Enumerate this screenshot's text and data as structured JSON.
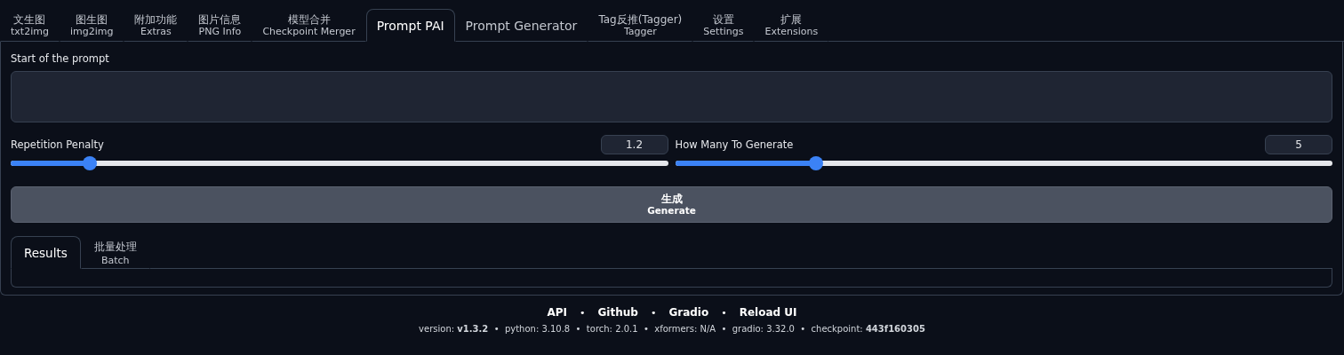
{
  "tabs": [
    {
      "label": "文生图",
      "sub": "txt2img",
      "selected": false
    },
    {
      "label": "图生图",
      "sub": "img2img",
      "selected": false
    },
    {
      "label": "附加功能",
      "sub": "Extras",
      "selected": false
    },
    {
      "label": "图片信息",
      "sub": "PNG Info",
      "selected": false
    },
    {
      "label": "模型合并",
      "sub": "Checkpoint Merger",
      "selected": false
    },
    {
      "label": "Prompt PAI",
      "selected": true
    },
    {
      "label": "Prompt Generator",
      "selected": false
    },
    {
      "label": "Tag反推(Tagger)",
      "sub": "Tagger",
      "selected": false
    },
    {
      "label": "设置",
      "sub": "Settings",
      "selected": false
    },
    {
      "label": "扩展",
      "sub": "Extensions",
      "selected": false
    }
  ],
  "prompt_field": {
    "label": "Start of the prompt"
  },
  "sliders": [
    {
      "label": "Repetition Penalty",
      "value": "1.2",
      "level": 0.12
    },
    {
      "label": "How Many To Generate",
      "value": "5",
      "level": 0.215
    }
  ],
  "generate_button": {
    "label": "生成",
    "sub": "Generate"
  },
  "result_tabs": [
    {
      "label": "Results",
      "selected": true
    },
    {
      "label": "批量处理",
      "sub": "Batch",
      "selected": false
    }
  ],
  "footer": {
    "links": [
      "API",
      "Github",
      "Gradio",
      "Reload UI"
    ],
    "separators": [
      "•",
      "•",
      "•"
    ],
    "version_line": "version: **v1.3.2**  •  python: 3.10.8  •  torch: 2.0.1  •  xformers: N/A  •  gradio: 3.32.0  •  checkpoint: **443f160305**"
  }
}
